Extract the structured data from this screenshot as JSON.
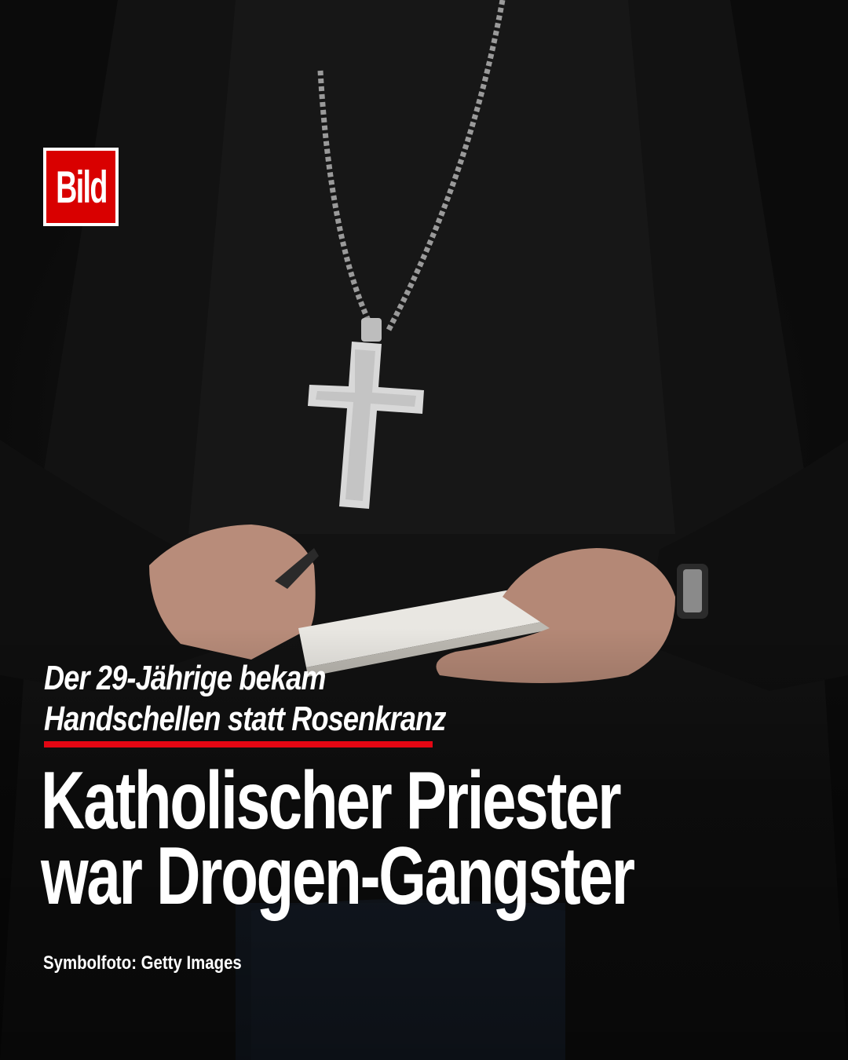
{
  "brand": {
    "logo_text": "Bild",
    "color": "#d90000"
  },
  "kicker": {
    "line1": "Der 29-Jährige bekam",
    "line2": "Handschellen statt Rosenkranz"
  },
  "headline": {
    "line1": "Katholischer Priester",
    "line2": "war Drogen-Gangster"
  },
  "credit": "Symbolfoto: Getty Images",
  "colors": {
    "accent": "#e30613",
    "text": "#ffffff",
    "background": "#0b0b0b"
  }
}
